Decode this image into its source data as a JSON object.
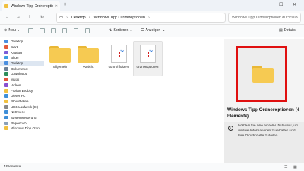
{
  "tab": {
    "title": "Windows Tipp Ordneroptionen",
    "close": "✕"
  },
  "window": {
    "new_tab": "+",
    "minimize": "—",
    "maximize": "☐",
    "close": "✕"
  },
  "address": {
    "nav": [
      "←",
      "→",
      "↑",
      "↻"
    ],
    "crumbs": [
      "Desktop",
      "Windows Tipp Ordneroptionen"
    ],
    "search_placeholder": "Windows Tipp Ordneroptionen durchsuchen"
  },
  "toolbar": {
    "new": "Neu",
    "sort": "Sortieren",
    "view": "Anzeigen",
    "more": "···",
    "details": "Details"
  },
  "sidebar": {
    "items": [
      {
        "label": "Desktop",
        "color": "#4a8fe0"
      },
      {
        "label": "Start",
        "color": "#e35b3b"
      },
      {
        "label": "Katalog",
        "color": "#7a5fd8"
      },
      {
        "label": "Bilder",
        "color": "#3a9ee0"
      },
      {
        "label": "Desktop",
        "color": "#4a8fe0"
      },
      {
        "label": "Dokumente",
        "color": "#6b7f95"
      },
      {
        "label": "Downloads",
        "color": "#2d8d5a"
      },
      {
        "label": "Musik",
        "color": "#e3543d"
      },
      {
        "label": "Videos",
        "color": "#8a4fd0"
      },
      {
        "label": "Florian Bodoky",
        "color": "#f0c040"
      },
      {
        "label": "Dieser PC",
        "color": "#3f8fd8"
      },
      {
        "label": "Bibliotheken",
        "color": "#f0c040"
      },
      {
        "label": "USB-Laufwerk (E:)",
        "color": "#888888"
      },
      {
        "label": "Netzwerk",
        "color": "#3f8fd8"
      },
      {
        "label": "Systemsteuerung",
        "color": "#3f8fd8"
      },
      {
        "label": "Papierkorb",
        "color": "#8aa0b8"
      },
      {
        "label": "Windows Tipp Ordn",
        "color": "#f0c040"
      }
    ],
    "selected_index": 4
  },
  "files": [
    {
      "label": "Allgemein",
      "type": "folder"
    },
    {
      "label": "Ansicht",
      "type": "folder"
    },
    {
      "label": "control folders",
      "type": "doc"
    },
    {
      "label": "ordneroptionen",
      "type": "doc"
    }
  ],
  "preview": {
    "title": "Windows Tipp Ordneroptionen (4 Elemente)",
    "info": "Wählen Sie eine einzelne Datei aus, um weitere Informationen zu erhalten und Ihre Cloudinhalte zu teilen."
  },
  "status": {
    "count": "4 Elemente",
    "view_list": "☰",
    "view_grid": "▦"
  },
  "colors": {
    "accent": "#0067c0",
    "highlight": "#e01010",
    "folder": "#f6ca52"
  }
}
